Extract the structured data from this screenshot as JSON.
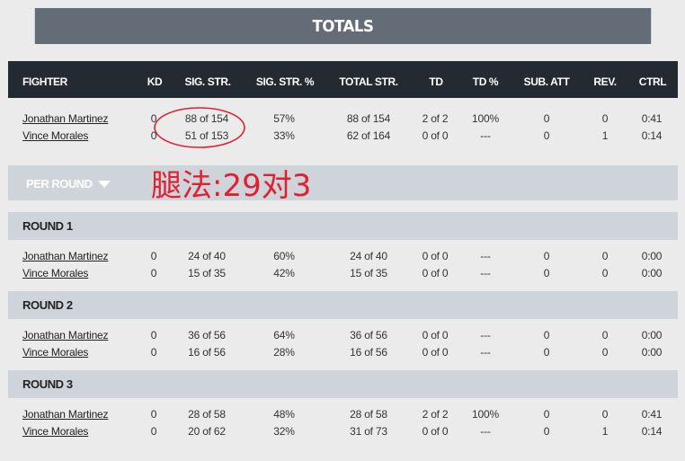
{
  "totals_title": "TOTALS",
  "columns": [
    "FIGHTER",
    "KD",
    "SIG. STR.",
    "SIG. STR. %",
    "TOTAL STR.",
    "TD",
    "TD %",
    "SUB. ATT",
    "REV.",
    "CTRL"
  ],
  "totals": [
    [
      "Jonathan Martinez",
      "0",
      "88 of 154",
      "57%",
      "88 of 154",
      "2 of 2",
      "100%",
      "0",
      "0",
      "0:41"
    ],
    [
      "Vince Morales",
      "0",
      "51 of 153",
      "33%",
      "62 of 164",
      "0 of 0",
      "---",
      "0",
      "1",
      "0:14"
    ]
  ],
  "per_round_label": "PER ROUND",
  "rounds": [
    {
      "label": "ROUND 1",
      "rows": [
        [
          "Jonathan Martinez",
          "0",
          "24 of 40",
          "60%",
          "24 of 40",
          "0 of 0",
          "---",
          "0",
          "0",
          "0:00"
        ],
        [
          "Vince Morales",
          "0",
          "15 of 35",
          "42%",
          "15 of 35",
          "0 of 0",
          "---",
          "0",
          "0",
          "0:00"
        ]
      ]
    },
    {
      "label": "ROUND 2",
      "rows": [
        [
          "Jonathan Martinez",
          "0",
          "36 of 56",
          "64%",
          "36 of 56",
          "0 of 0",
          "---",
          "0",
          "0",
          "0:00"
        ],
        [
          "Vince Morales",
          "0",
          "16 of 56",
          "28%",
          "16 of 56",
          "0 of 0",
          "---",
          "0",
          "0",
          "0:00"
        ]
      ]
    },
    {
      "label": "ROUND 3",
      "rows": [
        [
          "Jonathan Martinez",
          "0",
          "28 of 58",
          "48%",
          "28 of 58",
          "2 of 2",
          "100%",
          "0",
          "0",
          "0:41"
        ],
        [
          "Vince Morales",
          "0",
          "20 of 62",
          "32%",
          "31 of 73",
          "0 of 0",
          "---",
          "0",
          "1",
          "0:14"
        ]
      ]
    }
  ],
  "annotation": {
    "text": "腿法:29对3",
    "color": "#e02030"
  },
  "colors": {
    "totals_bar": "#636c77",
    "header_bar": "#242a32",
    "section_bar": "#cfd3da",
    "background": "#ebebeb"
  }
}
